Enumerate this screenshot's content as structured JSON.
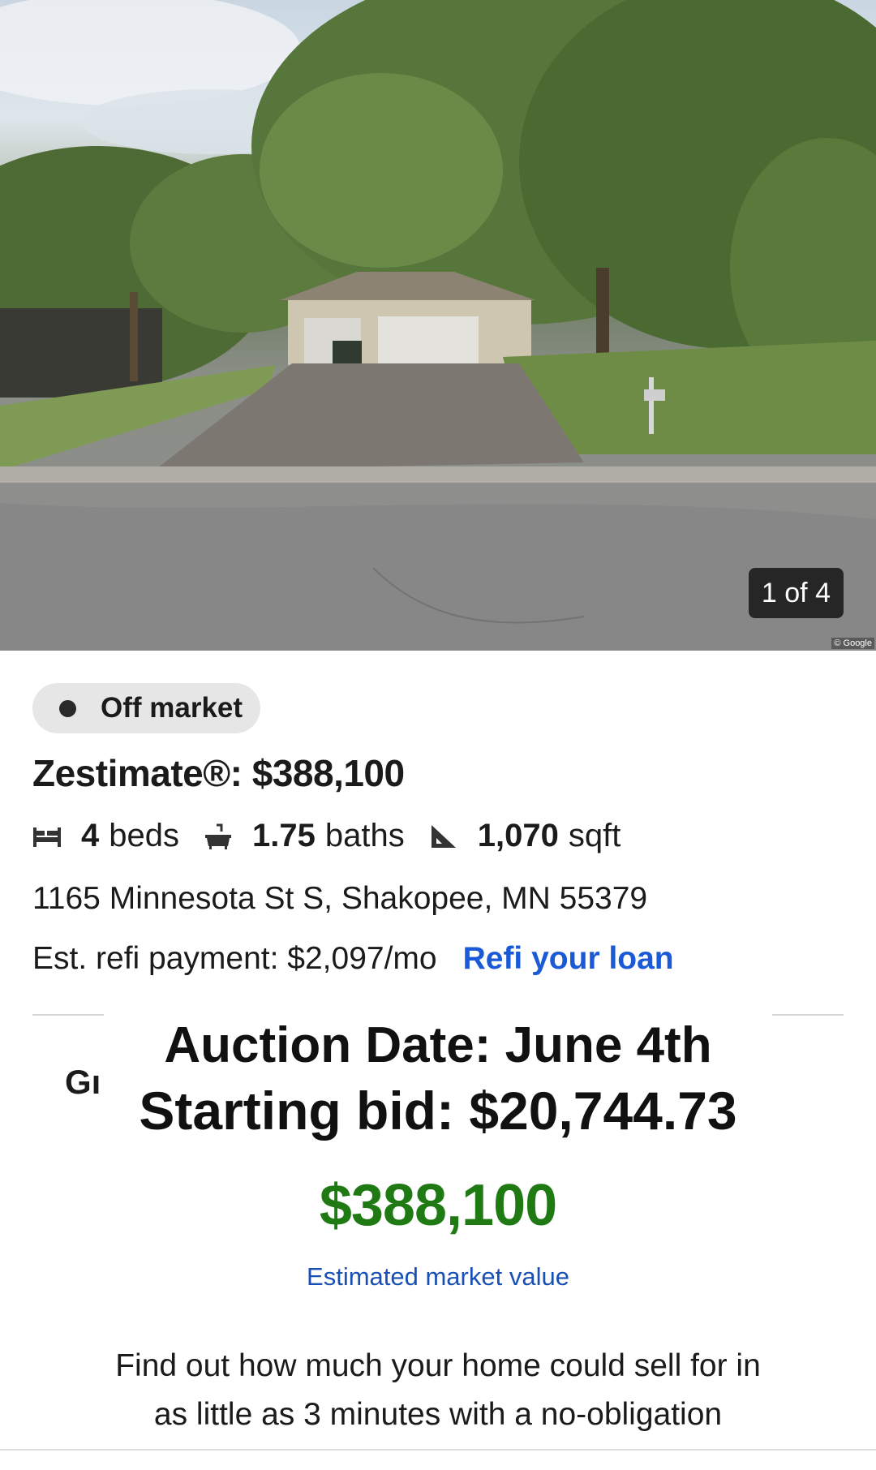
{
  "photo": {
    "counter": "1 of 4",
    "credit": "© Google"
  },
  "listing": {
    "status": "Off market",
    "zestimate": "Zestimate®: $388,100",
    "facts": {
      "beds_value": "4",
      "beds_label": "beds",
      "baths_value": "1.75",
      "baths_label": "baths",
      "sqft_value": "1,070",
      "sqft_label": "sqft"
    },
    "address": "1165 Minnesota St S, Shakopee, MN 55379",
    "refi_payment": "Est. refi payment: $2,097/mo",
    "refi_link": "Refi your loan"
  },
  "overlay": {
    "auction_date": "Auction Date: June 4th",
    "starting_bid": "Starting bid: $20,744.73"
  },
  "sell_card": {
    "heading_peek": "Gı",
    "value": "$388,100",
    "value_label": "Estimated market value",
    "body": "Find out how much your home could sell for in as little as 3 minutes with a no-obligation"
  },
  "colors": {
    "link_blue": "#1a5ad6",
    "value_green": "#1f7a14",
    "pill_gray": "#e6e6e6"
  }
}
